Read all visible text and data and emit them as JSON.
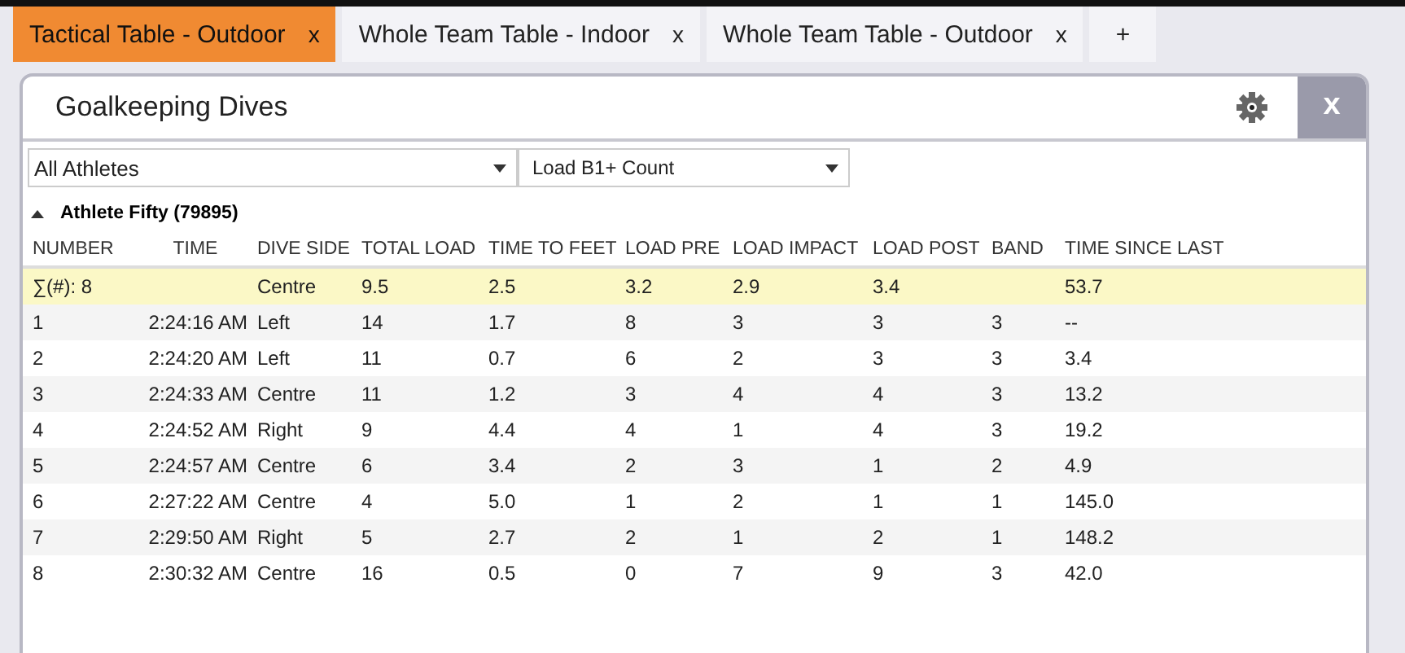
{
  "tabs": [
    {
      "label": "Tactical Table - Outdoor",
      "close": "x",
      "selected": true
    },
    {
      "label": "Whole Team Table - Indoor",
      "close": "x",
      "selected": false
    },
    {
      "label": "Whole Team Table - Outdoor",
      "close": "x",
      "selected": false
    }
  ],
  "add_tab": "+",
  "panel": {
    "title": "Goalkeeping Dives",
    "close": "x"
  },
  "filters": [
    {
      "value": "All Athletes"
    },
    {
      "value": "Load B1+ Count"
    }
  ],
  "group": {
    "label": "Athlete Fifty (79895)",
    "expanded": true
  },
  "table": {
    "columns": [
      "NUMBER",
      "TIME",
      "DIVE SIDE",
      "TOTAL LOAD",
      "TIME TO FEET",
      "LOAD PRE",
      "LOAD IMPACT",
      "LOAD POST",
      "BAND",
      "TIME SINCE LAST"
    ],
    "summary": {
      "number": "∑(#): 8",
      "dive_side": "Centre",
      "total_load": "9.5",
      "time_to_feet": "2.5",
      "load_pre": "3.2",
      "load_impact": "2.9",
      "load_post": "3.4",
      "time_since_last": "53.7"
    },
    "rows": [
      [
        "1",
        "2:24:16 AM",
        "Left",
        "14",
        "1.7",
        "8",
        "3",
        "3",
        "3",
        "--"
      ],
      [
        "2",
        "2:24:20 AM",
        "Left",
        "11",
        "0.7",
        "6",
        "2",
        "3",
        "3",
        "3.4"
      ],
      [
        "3",
        "2:24:33 AM",
        "Centre",
        "11",
        "1.2",
        "3",
        "4",
        "4",
        "3",
        "13.2"
      ],
      [
        "4",
        "2:24:52 AM",
        "Right",
        "9",
        "4.4",
        "4",
        "1",
        "4",
        "3",
        "19.2"
      ],
      [
        "5",
        "2:24:57 AM",
        "Centre",
        "6",
        "3.4",
        "2",
        "3",
        "1",
        "2",
        "4.9"
      ],
      [
        "6",
        "2:27:22 AM",
        "Centre",
        "4",
        "5.0",
        "1",
        "2",
        "1",
        "1",
        "145.0"
      ],
      [
        "7",
        "2:29:50 AM",
        "Right",
        "5",
        "2.7",
        "2",
        "1",
        "2",
        "1",
        "148.2"
      ],
      [
        "8",
        "2:30:32 AM",
        "Centre",
        "16",
        "0.5",
        "0",
        "7",
        "9",
        "3",
        "42.0"
      ]
    ]
  }
}
